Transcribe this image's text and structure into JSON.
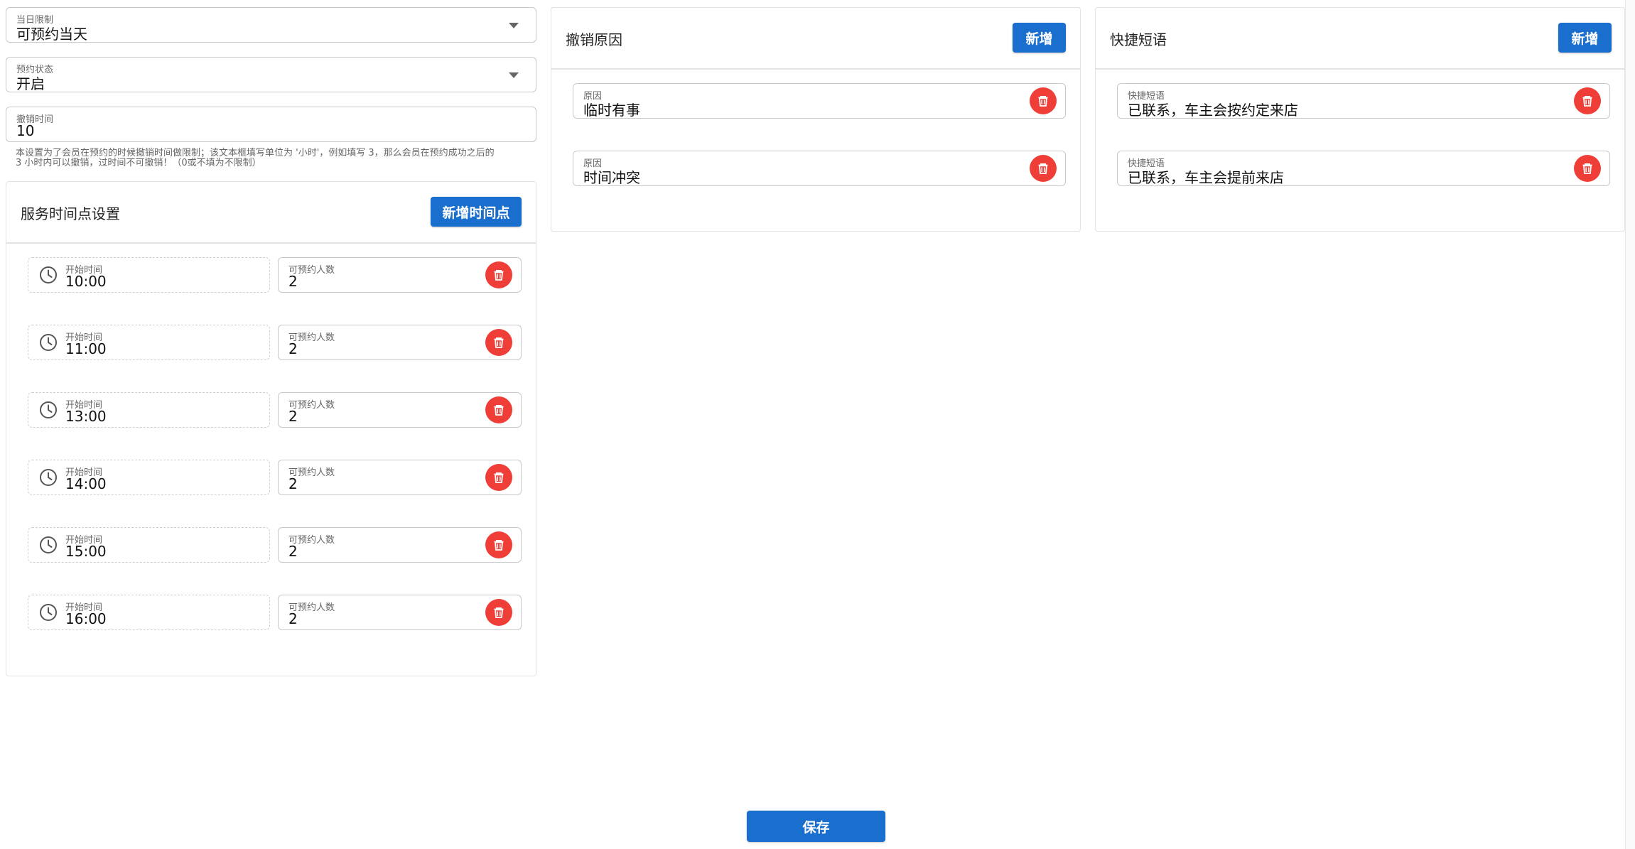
{
  "settings": {
    "daily_limit": {
      "label": "当日限制",
      "value": "可预约当天"
    },
    "booking_status": {
      "label": "预约状态",
      "value": "开启"
    },
    "cancel_time": {
      "label": "撤销时间",
      "value": "10"
    },
    "hint_line1": "本设置为了会员在预约的时候撤销时间做限制；该文本框填写单位为 '小时'，例如填写 3，那么会员在预约成功之后的",
    "hint_line2": "3 小时内可以撤销，过时间不可撤销！（0或不填为不限制）"
  },
  "service_times": {
    "title": "服务时间点设置",
    "add_label": "新增时间点",
    "start_label": "开始时间",
    "count_label": "可预约人数",
    "rows": [
      {
        "start": "10:00",
        "count": "2"
      },
      {
        "start": "11:00",
        "count": "2"
      },
      {
        "start": "13:00",
        "count": "2"
      },
      {
        "start": "14:00",
        "count": "2"
      },
      {
        "start": "15:00",
        "count": "2"
      },
      {
        "start": "16:00",
        "count": "2"
      }
    ]
  },
  "cancel_reasons": {
    "title": "撤销原因",
    "add_label": "新增",
    "item_label": "原因",
    "items": [
      "临时有事",
      "时间冲突"
    ]
  },
  "quick_phrases": {
    "title": "快捷短语",
    "add_label": "新增",
    "item_label": "快捷短语",
    "items": [
      "已联系，车主会按约定来店",
      "已联系，车主会提前来店"
    ]
  },
  "save_label": "保存",
  "colors": {
    "primary": "#1a6fce",
    "danger": "#ef3e37"
  }
}
